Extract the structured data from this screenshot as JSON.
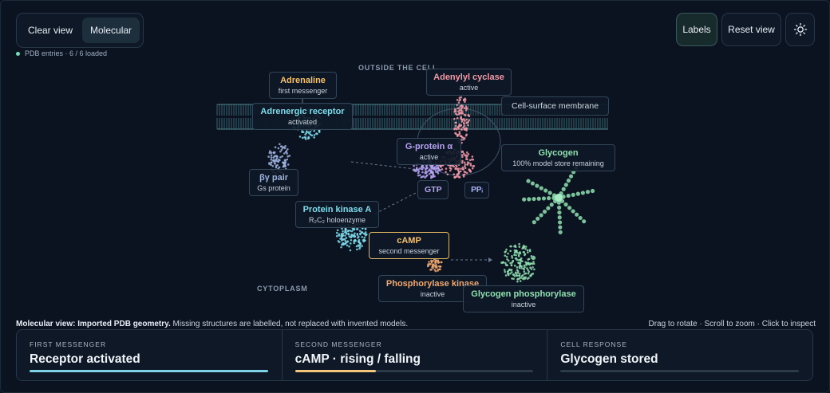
{
  "toolbar": {
    "clear_view": "Clear view",
    "molecular": "Molecular",
    "labels": "Labels",
    "reset_view": "Reset view",
    "theme_icon": "sun-icon"
  },
  "status": {
    "text": "PDB entries · 6 / 6 loaded"
  },
  "regions": {
    "outside": "OUTSIDE THE CELL",
    "cytoplasm": "CYTOPLASM"
  },
  "labels": {
    "adrenaline": {
      "title": "Adrenaline",
      "sub": "first messenger"
    },
    "receptor": {
      "title": "Adrenergic receptor",
      "sub": "activated"
    },
    "cyclase": {
      "title": "Adenylyl cyclase",
      "sub": "active"
    },
    "membrane": {
      "title": "Cell-surface membrane"
    },
    "gprotein": {
      "title": "G-protein α",
      "sub": "active"
    },
    "gtp": {
      "title": "GTP"
    },
    "ppi": {
      "title": "PPᵢ"
    },
    "glycogen": {
      "title": "Glycogen",
      "sub": "100% model store remaining"
    },
    "betagamma": {
      "title": "βγ pair",
      "sub": "Gs protein"
    },
    "pka": {
      "title": "Protein kinase A",
      "sub": "R₂C₂ holoenzyme"
    },
    "camp": {
      "title": "cAMP",
      "sub": "second messenger"
    },
    "phk": {
      "title": "Phosphorylase kinase",
      "sub": "inactive"
    },
    "gp": {
      "title": "Glycogen phosphorylase",
      "sub": "inactive"
    }
  },
  "caption": {
    "bold": "Molecular view: Imported PDB geometry.",
    "rest": " Missing structures are labelled, not replaced with invented models."
  },
  "hint": "Drag to rotate · Scroll to zoom · Click to inspect",
  "cards": [
    {
      "key": "FIRST MESSENGER",
      "value": "Receptor activated",
      "progress": 1.0,
      "color": "#7dd3e8"
    },
    {
      "key": "SECOND MESSENGER",
      "value": "cAMP · rising / falling",
      "progress": 0.34,
      "color": "#f3c77a"
    },
    {
      "key": "CELL RESPONSE",
      "value": "Glycogen stored",
      "progress": 0.0,
      "color": "#86d9a8"
    }
  ],
  "colors": {
    "adrenaline": "#f5c06b",
    "receptor": "#7fdcec",
    "cyclase": "#f29aa8",
    "gprotein": "#b7a4f5",
    "glycogen": "#8fe0b0",
    "pka": "#7fdcec",
    "camp": "#f5c06b",
    "phk": "#f0a870",
    "gp": "#8fe0b0"
  }
}
